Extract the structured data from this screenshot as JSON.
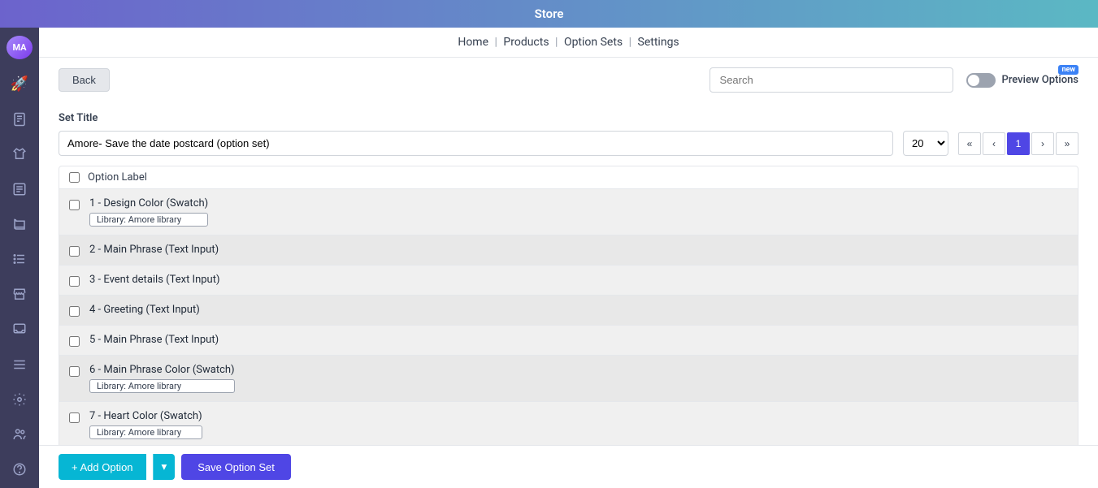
{
  "topBar": {
    "title": "Store"
  },
  "nav": {
    "items": [
      "Home",
      "Products",
      "Option Sets",
      "Settings"
    ],
    "separator": "|"
  },
  "toolbar": {
    "backLabel": "Back",
    "searchPlaceholder": "Search",
    "previewLabel": "Preview Options",
    "newBadge": "new"
  },
  "setTitle": {
    "label": "Set Title",
    "value": "Amore- Save the date postcard (option set)",
    "perPageValue": "20"
  },
  "pagination": {
    "first": "«",
    "prev": "‹",
    "current": "1",
    "next": "›",
    "last": "»"
  },
  "optionsHeader": {
    "label": "Option Label"
  },
  "options": [
    {
      "id": 1,
      "title": "1 - Design Color (Swatch)",
      "library": "Library: Amore library"
    },
    {
      "id": 2,
      "title": "2 - Main Phrase (Text Input)",
      "library": null
    },
    {
      "id": 3,
      "title": "3 - Event details (Text Input)",
      "library": null
    },
    {
      "id": 4,
      "title": "4 - Greeting (Text Input)",
      "library": null
    },
    {
      "id": 5,
      "title": "5 - Main Phrase (Text Input)",
      "library": null
    },
    {
      "id": 6,
      "title": "6 - Main Phrase Color (Swatch)",
      "library": "Library: Amore library"
    },
    {
      "id": 7,
      "title": "7 - Heart Color (Swatch)",
      "library": "Library: Amore library"
    }
  ],
  "bottomBar": {
    "addOptionLabel": "+ Add Option",
    "saveLabel": "Save Option Set"
  },
  "sidebar": {
    "avatar": "MA",
    "icons": [
      "🚀",
      "📄",
      "👕",
      "📋",
      "📖",
      "☰",
      "🏪",
      "📥",
      "≡",
      "⚙",
      "👥",
      "❓"
    ]
  }
}
